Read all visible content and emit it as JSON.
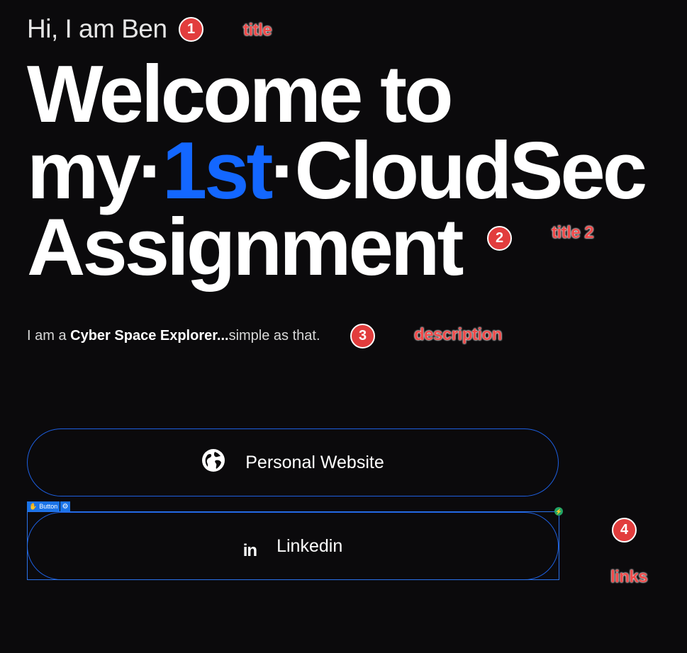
{
  "title": {
    "greeting": "Hi, I am Ben"
  },
  "headline": {
    "line1": "Welcome to",
    "line2_prefix": "my·",
    "line2_accent": "1st",
    "line2_suffix": "·CloudSec",
    "line3": "Assignment",
    "accent_color": "#1367ff"
  },
  "description": {
    "lead": "I am a ",
    "bold": "Cyber Space Explorer...",
    "tail": "simple as that."
  },
  "links": [
    {
      "label": "Personal Website",
      "icon": "globe-icon"
    },
    {
      "label": "Linkedin",
      "icon": "linkedin-icon",
      "icon_text": "in"
    }
  ],
  "editor": {
    "selection_label": "Button",
    "selection_glyph": "✋",
    "gear_glyph": "⚙",
    "bolt_glyph": "⚡"
  },
  "annotations": {
    "markers": [
      "1",
      "2",
      "3",
      "4"
    ],
    "notes": [
      "title",
      "title 2",
      "description",
      "links"
    ]
  },
  "colors": {
    "background": "#0b0a0c",
    "accent": "#1367ff",
    "button_border": "#1d5fe0",
    "annotation": "#e23d3d",
    "editor_blue": "#1a73e8"
  }
}
